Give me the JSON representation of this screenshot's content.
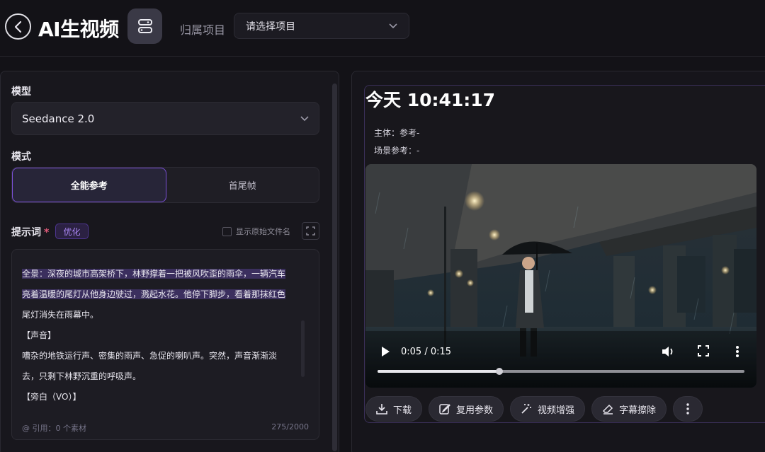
{
  "header": {
    "title": "AI生视频",
    "project_label": "归属项目",
    "project_placeholder": "请选择项目"
  },
  "form": {
    "model_label": "模型",
    "model_value": "Seedance 2.0",
    "mode_label": "模式",
    "modes": [
      "全能参考",
      "首尾帧"
    ],
    "active_mode": "全能参考",
    "prompt_label": "提示词",
    "required_mark": "*",
    "optimize_label": "优化",
    "show_filename_label": "显示原始文件名",
    "prompt_lines": [
      "全景：深夜的城市高架桥下，林野撑着一把被风吹歪的雨伞，一辆汽车",
      "亮着温暖的尾灯从他身边驶过，溅起水花。他停下脚步，看着那抹红色",
      "尾灯消失在雨幕中。",
      "【声音】",
      "嘈杂的地铁运行声、密集的雨声、急促的喇叭声。突然，声音渐渐淡",
      "去，只剩下林野沉重的呼吸声。",
      "【旁白（VO）】"
    ],
    "reference_text": "@ 引用：0 个素材",
    "char_count": "275/2000"
  },
  "result": {
    "time": "今天 10:41:17",
    "subject_ref": "主体：参考-",
    "scene_ref": "场景参考：-",
    "video": {
      "time_display": "0:05 / 0:15",
      "progress": 0.333
    },
    "actions": [
      "下载",
      "复用参数",
      "视频增强",
      "字幕擦除"
    ]
  },
  "colors": {
    "accent": "#7b50d8",
    "background": "#131217",
    "panel": "#18171d"
  }
}
